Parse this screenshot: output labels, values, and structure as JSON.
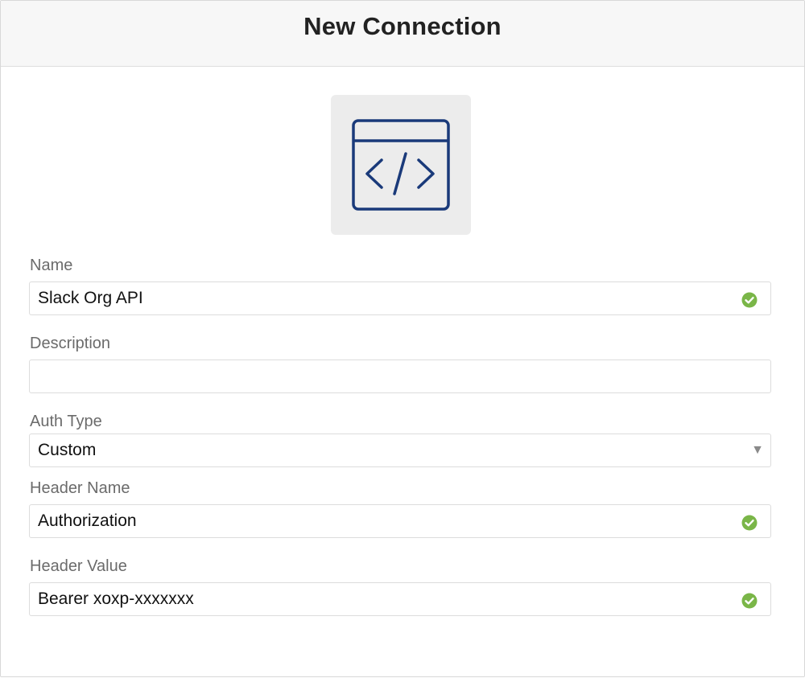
{
  "header": {
    "title": "New Connection"
  },
  "icon": {
    "name": "code-window-icon",
    "color": "#1a3a7a"
  },
  "fields": {
    "name": {
      "label": "Name",
      "value": "Slack Org API",
      "valid": true
    },
    "description": {
      "label": "Description",
      "value": ""
    },
    "auth_type": {
      "label": "Auth Type",
      "value": "Custom"
    },
    "header_name": {
      "label": "Header Name",
      "value": "Authorization",
      "valid": true
    },
    "header_value": {
      "label": "Header Value",
      "value": "Bearer xoxp-xxxxxxx",
      "valid": true
    }
  },
  "colors": {
    "valid_check": "#7ab648",
    "header_bg": "#f7f7f7"
  }
}
